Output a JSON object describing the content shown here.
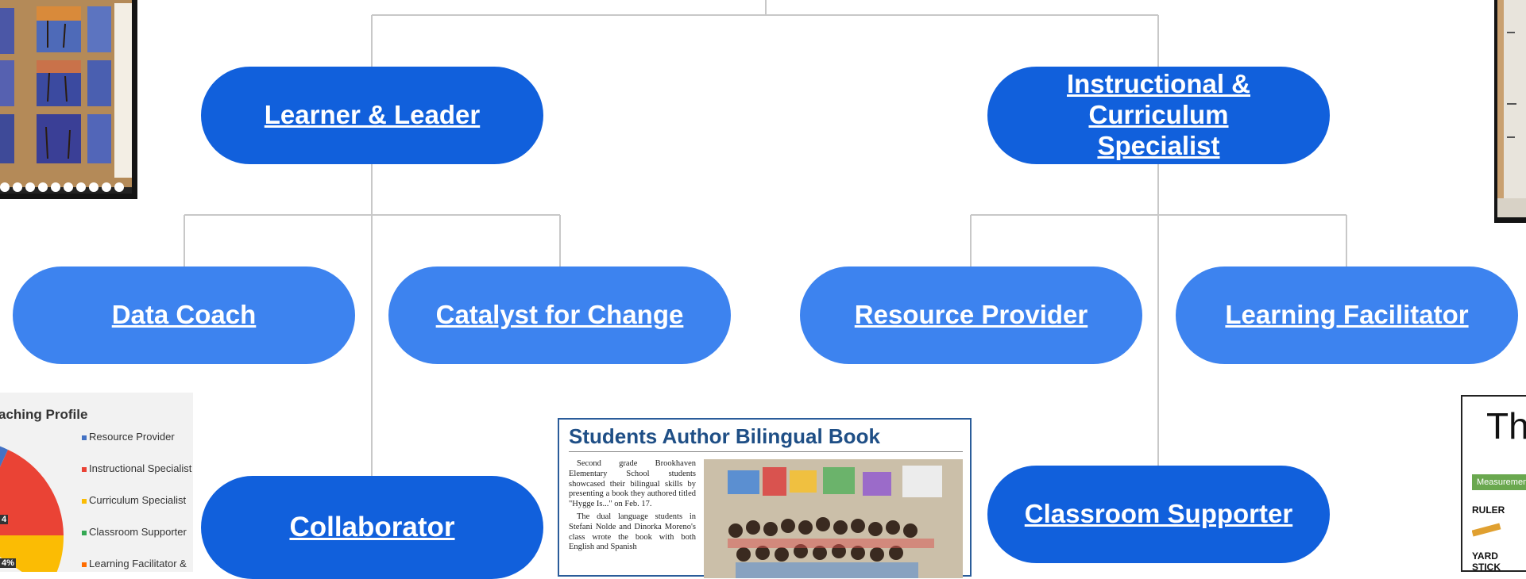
{
  "nodes": {
    "learner_leader": "Learner & Leader",
    "instructional_specialist": "Instructional & Curriculum Specialist",
    "data_coach": "Data Coach",
    "catalyst": "Catalyst for Change",
    "resource_provider": "Resource Provider",
    "learning_facilitator": "Learning Facilitator",
    "collaborator": "Collaborator",
    "classroom_supporter": "Classroom Supporter"
  },
  "colors": {
    "dark_node": "#1160dc",
    "light_node": "#3d83ef",
    "connector": "#c8c8c8",
    "headline": "#1f4f86"
  },
  "newspaper": {
    "headline": "Students Author Bilingual Book",
    "paragraph1": "Second grade Brookhaven Elementary School students showcased their bilingual skills by presenting a book they authored titled \"Hygge Is...\" on Feb. 17.",
    "paragraph2": "The dual language students in Stefani Nolde and Dinorka Moreno's class wrote the book with both English and Spanish"
  },
  "coaching_chart": {
    "title": "aching Profile",
    "legend": [
      "Resource Provider",
      "Instructional Specialist",
      "Curriculum Specialist",
      "Classroom Supporter",
      "Learning Facilitator &"
    ],
    "legend_colors": [
      "#4472c4",
      "#ea4335",
      "#fbbc04",
      "#34a853",
      "#ff6d01"
    ],
    "visible_labels": [
      "4",
      "4%"
    ]
  },
  "measurement_poster": {
    "title_fragment": "Thi",
    "banner": "Measurement",
    "item1": "RULER",
    "item2": "YARD STICK"
  }
}
